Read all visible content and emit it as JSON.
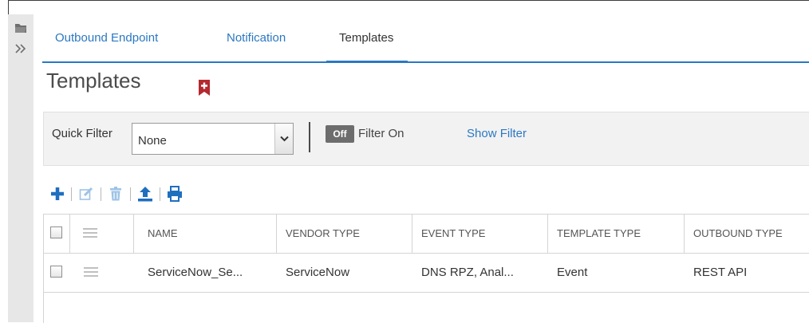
{
  "tabs": [
    {
      "label": "Outbound Endpoint"
    },
    {
      "label": "Notification"
    },
    {
      "label": "Templates"
    }
  ],
  "page": {
    "title": "Templates"
  },
  "filter": {
    "quick_filter_label": "Quick Filter",
    "quick_filter_value": "None",
    "toggle_label": "Off",
    "filter_on_label": "Filter On",
    "show_filter_label": "Show Filter"
  },
  "toolbar": {
    "icons": [
      "add-icon",
      "edit-icon",
      "delete-icon",
      "export-icon",
      "print-icon"
    ]
  },
  "table": {
    "columns": [
      "NAME",
      "VENDOR TYPE",
      "EVENT TYPE",
      "TEMPLATE TYPE",
      "OUTBOUND TYPE"
    ],
    "rows": [
      {
        "name": "ServiceNow_Se...",
        "vendor_type": "ServiceNow",
        "event_type": "DNS RPZ, Anal...",
        "template_type": "Event",
        "outbound_type": "REST API"
      }
    ]
  },
  "colors": {
    "accent": "#2b78c2",
    "bookmark": "#b42a2f",
    "toggle_bg": "#6d6d6d"
  }
}
